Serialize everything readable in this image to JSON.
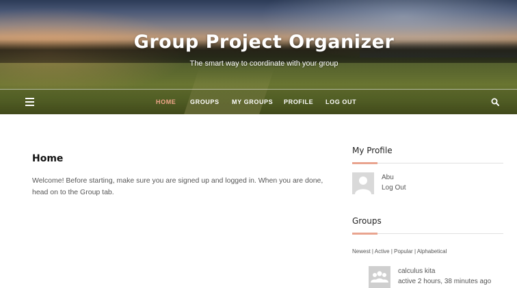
{
  "site": {
    "title": "Group Project Organizer",
    "tagline": "The smart way to coordinate with your group"
  },
  "nav": {
    "menu_icon": "hamburger-icon",
    "items": [
      {
        "label": "HOME",
        "active": true
      },
      {
        "label": "GROUPS",
        "active": false
      },
      {
        "label": "MY GROUPS",
        "active": false
      },
      {
        "label": "PROFILE",
        "active": false
      },
      {
        "label": "LOG OUT",
        "active": false
      }
    ],
    "search_icon": "search-icon"
  },
  "main": {
    "title": "Home",
    "body": "Welcome! Before starting, make sure you are signed up and logged in. When you are done, head on to the Group tab."
  },
  "sidebar": {
    "profile_widget": {
      "title": "My Profile",
      "username": "Abu",
      "logout_label": "Log Out",
      "avatar_icon": "default-user-avatar"
    },
    "groups_widget": {
      "title": "Groups",
      "filters": [
        "Newest",
        "Active",
        "Popular",
        "Alphabetical"
      ],
      "groups": [
        {
          "name": "calculus kita",
          "activity": "active 2 hours, 38 minutes ago",
          "avatar_icon": "default-group-avatar"
        }
      ]
    }
  },
  "colors": {
    "accent": "#e9a48f",
    "active_nav": "#f0a58a",
    "text": "#555555",
    "heading": "#222222"
  }
}
